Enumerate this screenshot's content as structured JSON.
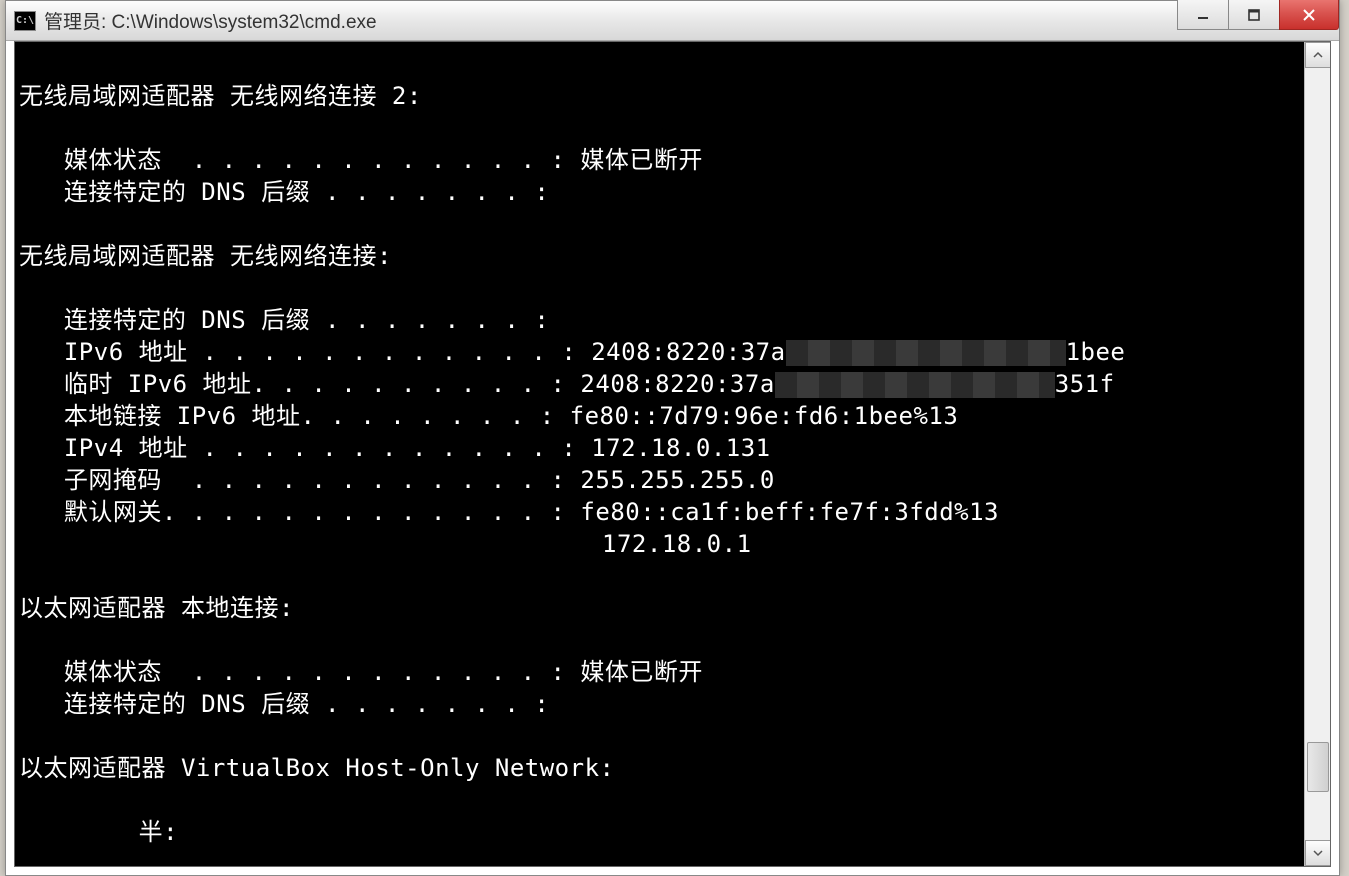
{
  "window": {
    "icon_label": "C:\\",
    "title": "管理员: C:\\Windows\\system32\\cmd.exe"
  },
  "console": {
    "lines": [
      "",
      "无线局域网适配器 无线网络连接 2:",
      "",
      "   媒体状态  . . . . . . . . . . . . : 媒体已断开",
      "   连接特定的 DNS 后缀 . . . . . . . :",
      "",
      "无线局域网适配器 无线网络连接:",
      "",
      "   连接特定的 DNS 后缀 . . . . . . . :",
      "   IPv6 地址 . . . . . . . . . . . . : 2408:8220:37a[REDACT:280]1bee",
      "   临时 IPv6 地址. . . . . . . . . . : 2408:8220:37a[REDACT:280]351f",
      "   本地链接 IPv6 地址. . . . . . . . : fe80::7d79:96e:fd6:1bee%13",
      "   IPv4 地址 . . . . . . . . . . . . : 172.18.0.131",
      "   子网掩码  . . . . . . . . . . . . : 255.255.255.0",
      "   默认网关. . . . . . . . . . . . . : fe80::ca1f:beff:fe7f:3fdd%13",
      "                                       172.18.0.1",
      "",
      "以太网适配器 本地连接:",
      "",
      "   媒体状态  . . . . . . . . . . . . : 媒体已断开",
      "   连接特定的 DNS 后缀 . . . . . . . :",
      "",
      "以太网适配器 VirtualBox Host-Only Network:",
      "",
      "        半:"
    ]
  }
}
